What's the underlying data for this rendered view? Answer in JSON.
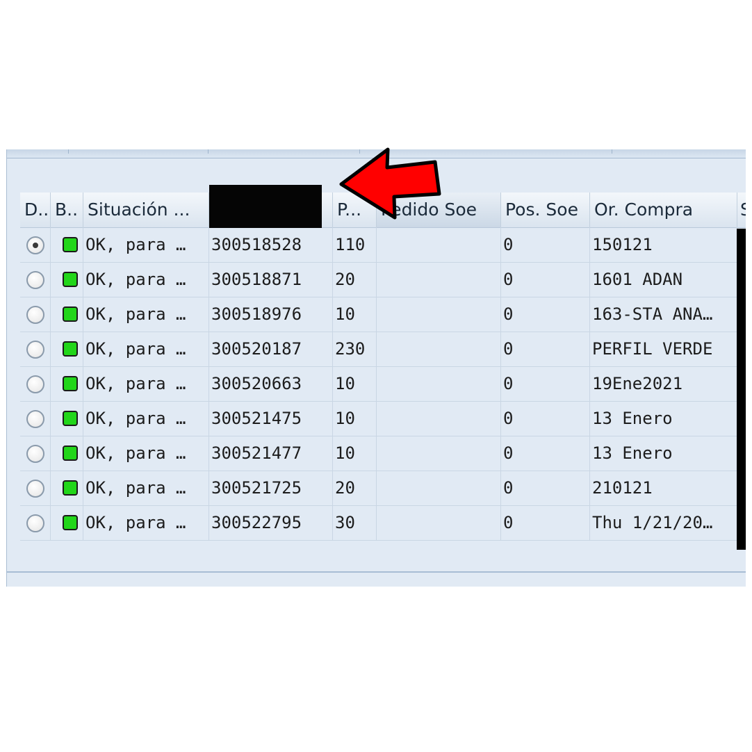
{
  "grid": {
    "columns": [
      "D..",
      "B..",
      "Situación ...",
      "",
      "P...",
      "Pedido Soe",
      "Pos. Soe",
      "Or. Compra",
      "S"
    ],
    "rows": [
      {
        "selected": true,
        "status_color": "#22d61a",
        "situacion": "OK, para …",
        "doc": "300518528",
        "pos": "110",
        "pedido_soe": "",
        "pos_soe": "0",
        "or_compra": "150121"
      },
      {
        "selected": false,
        "status_color": "#22d61a",
        "situacion": "OK, para …",
        "doc": "300518871",
        "pos": "20",
        "pedido_soe": "",
        "pos_soe": "0",
        "or_compra": "1601 ADAN"
      },
      {
        "selected": false,
        "status_color": "#22d61a",
        "situacion": "OK, para …",
        "doc": "300518976",
        "pos": "10",
        "pedido_soe": "",
        "pos_soe": "0",
        "or_compra": "163-STA ANA…"
      },
      {
        "selected": false,
        "status_color": "#22d61a",
        "situacion": "OK, para …",
        "doc": "300520187",
        "pos": "230",
        "pedido_soe": "",
        "pos_soe": "0",
        "or_compra": "PERFIL VERDE"
      },
      {
        "selected": false,
        "status_color": "#22d61a",
        "situacion": "OK, para …",
        "doc": "300520663",
        "pos": "10",
        "pedido_soe": "",
        "pos_soe": "0",
        "or_compra": "19Ene2021"
      },
      {
        "selected": false,
        "status_color": "#22d61a",
        "situacion": "OK, para …",
        "doc": "300521475",
        "pos": "10",
        "pedido_soe": "",
        "pos_soe": "0",
        "or_compra": "13 Enero"
      },
      {
        "selected": false,
        "status_color": "#22d61a",
        "situacion": "OK, para …",
        "doc": "300521477",
        "pos": "10",
        "pedido_soe": "",
        "pos_soe": "0",
        "or_compra": "13 Enero"
      },
      {
        "selected": false,
        "status_color": "#22d61a",
        "situacion": "OK, para …",
        "doc": "300521725",
        "pos": "20",
        "pedido_soe": "",
        "pos_soe": "0",
        "or_compra": "210121"
      },
      {
        "selected": false,
        "status_color": "#22d61a",
        "situacion": "OK, para …",
        "doc": "300522795",
        "pos": "30",
        "pedido_soe": "",
        "pos_soe": "0",
        "or_compra": "Thu 1/21/20…"
      }
    ]
  },
  "colors": {
    "accent_arrow": "#ff0000",
    "status_ok": "#22d61a",
    "panel_bg": "#e1eaf4"
  },
  "icons": {
    "annotation": "red-arrow-icon",
    "status": "green-status-icon",
    "select": "radio-button-icon"
  }
}
